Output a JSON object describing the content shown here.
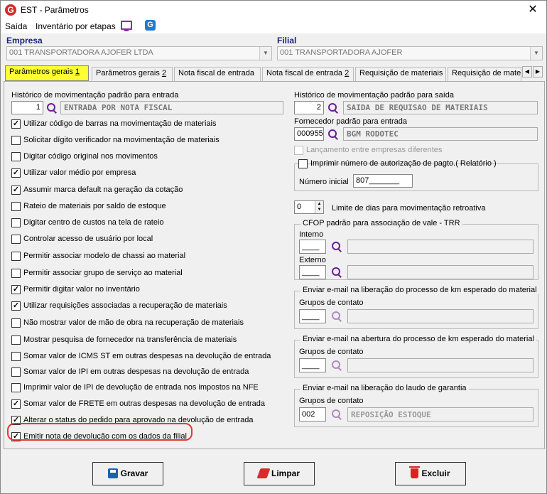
{
  "window": {
    "title": "EST - Parâmetros",
    "close_label": "✕"
  },
  "menu": {
    "items": [
      "Saída",
      "Inventário por etapas"
    ]
  },
  "empresa": {
    "label": "Empresa",
    "value": "001 TRANSPORTADORA AJOFER LTDA"
  },
  "filial": {
    "label": "Filial",
    "value": "001 TRANSPORTADORA AJOFER"
  },
  "tabs": [
    {
      "pre": "Parâmetros gerais ",
      "u": "1"
    },
    {
      "pre": "Parâmetros gerais ",
      "u": "2"
    },
    {
      "pre": "Nota fiscal de entrada",
      "u": ""
    },
    {
      "pre": "Nota fiscal de entrada ",
      "u": "2"
    },
    {
      "pre": "Requisição de materiais",
      "u": ""
    },
    {
      "pre": "Requisição de materi",
      "u": ""
    }
  ],
  "left": {
    "hist_label": "Histórico de movimentação padrão para entrada",
    "hist_code": "1",
    "hist_desc": "ENTRADA POR NOTA FISCAL",
    "checkboxes": [
      {
        "label": "Utilizar código de barras na movimentação de materiais",
        "checked": true
      },
      {
        "label": "Solicitar dígito verificador na movimentação de materiais",
        "checked": false
      },
      {
        "label": "Digitar código original nos movimentos",
        "checked": false
      },
      {
        "label": "Utilizar valor médio por empresa",
        "checked": true
      },
      {
        "label": "Assumir marca default na geração da cotação",
        "checked": true
      },
      {
        "label": "Rateio de materiais por saldo de estoque",
        "checked": false
      },
      {
        "label": "Digitar centro de custos na tela de rateio",
        "checked": false
      },
      {
        "label": "Controlar acesso de usuário por local",
        "checked": false
      },
      {
        "label": "Permitir associar modelo de chassi ao material",
        "checked": false
      },
      {
        "label": "Permitir associar grupo de serviço ao material",
        "checked": false
      },
      {
        "label": "Permitir digitar valor no inventário",
        "checked": true
      },
      {
        "label": "Utilizar requisições associadas a recuperação de materiais",
        "checked": true
      },
      {
        "label": "Não mostrar valor de mão de obra na recuperação de materiais",
        "checked": false
      },
      {
        "label": "Mostrar pesquisa de fornecedor na transferência de materiais",
        "checked": false
      },
      {
        "label": "Somar valor de ICMS ST em outras despesas na devolução de entrada",
        "checked": false
      },
      {
        "label": "Somar valor de IPI em outras despesas na devolução de entrada",
        "checked": false
      },
      {
        "label": "Imprimir valor de IPI de devolução de entrada nos impostos na NFE",
        "checked": false
      },
      {
        "label": "Somar valor de FRETE em outras despesas na devolução de entrada",
        "checked": true
      },
      {
        "label": "Alterar o status do pedido para aprovado na devolução de entrada",
        "checked": true
      },
      {
        "label": "Emitir nota de devolução com os dados da filial",
        "checked": true
      }
    ]
  },
  "right": {
    "hist_saida_label": "Histórico de movimentação padrão para saída",
    "hist_saida_code": "2",
    "hist_saida_desc": "SAIDA DE REQUISAO DE MATERIAIS",
    "fornecedor_label": "Fornecedor padrão para entrada",
    "fornecedor_code": "000955",
    "fornecedor_desc": "BGM RODOTEC",
    "lancamento_label": "Lançamento entre empresas diferentes",
    "imprimir_label": "Imprimir número de autorização de pagto.( Relatório )",
    "numero_inicial_label": "Número inicial",
    "numero_inicial_value": "807_______",
    "limite_value": "0",
    "limite_label": "Limite de dias para movimentação retroativa",
    "cfop_title": "CFOP padrão para associação de vale - TRR",
    "interno_label": "Interno",
    "interno_value": "____",
    "externo_label": "Externo",
    "externo_value": "____",
    "email1_title": "Enviar e-mail na liberação do processo de km esperado do material",
    "email1_grupos_label": "Grupos de contato",
    "email1_code": "____",
    "email2_title": "Enviar e-mail na abertura do processo de km esperado do material",
    "email2_grupos_label": "Grupos de contato",
    "email2_code": "____",
    "email3_title": "Enviar e-mail na liberação do laudo de garantia",
    "email3_grupos_label": "Grupos de contato",
    "email3_code": "002",
    "email3_desc": "REPOSIÇÃO ESTOQUE"
  },
  "buttons": {
    "gravar": "Gravar",
    "limpar": "Limpar",
    "excluir": "Excluir"
  }
}
